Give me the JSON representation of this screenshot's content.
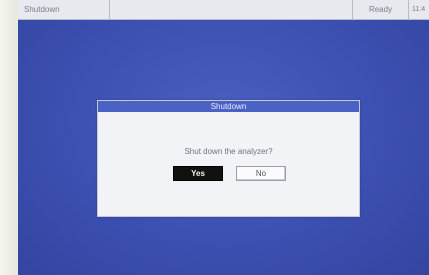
{
  "statusbar": {
    "title": "Shutdown",
    "state": "Ready",
    "time": "11:4"
  },
  "dialog": {
    "title": "Shutdown",
    "message": "Shut down the analyzer?",
    "yes_label": "Yes",
    "no_label": "No"
  },
  "colors": {
    "screen_background": "#3c50b2",
    "dialog_title_bar": "#4a62c6",
    "yes_button": "#111111"
  }
}
